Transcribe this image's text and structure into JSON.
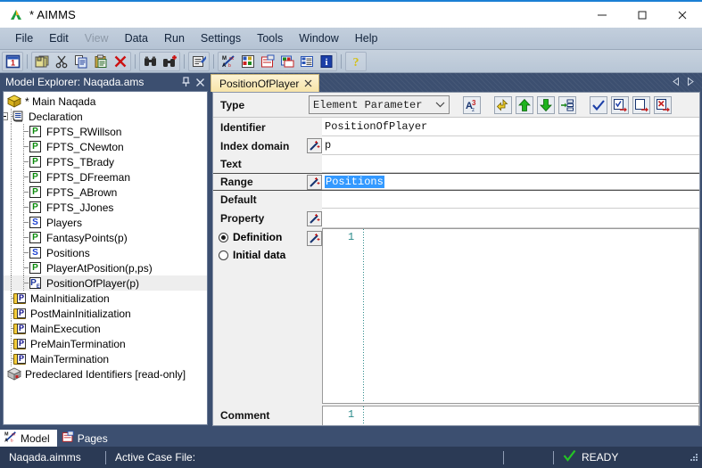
{
  "window": {
    "title": "* AIMMS",
    "logo_icon": "aimms-logo-icon",
    "minimize_label": "─",
    "maximize_label": "□",
    "close_label": "✕"
  },
  "menubar": {
    "items": [
      {
        "label": "File",
        "disabled": false
      },
      {
        "label": "Edit",
        "disabled": false
      },
      {
        "label": "View",
        "disabled": true
      },
      {
        "label": "Data",
        "disabled": false
      },
      {
        "label": "Run",
        "disabled": false
      },
      {
        "label": "Settings",
        "disabled": false
      },
      {
        "label": "Tools",
        "disabled": false
      },
      {
        "label": "Window",
        "disabled": false
      },
      {
        "label": "Help",
        "disabled": false
      }
    ]
  },
  "toolbar": {
    "groups": [
      {
        "buttons": [
          {
            "icon": "calendar-one-icon",
            "name": "new-project-button"
          }
        ]
      },
      {
        "buttons": [
          {
            "icon": "copy-stack-icon",
            "name": "duplicate-button"
          },
          {
            "icon": "scissors-icon",
            "name": "cut-button"
          },
          {
            "icon": "copy-icon",
            "name": "copy-button"
          },
          {
            "icon": "paste-icon",
            "name": "paste-button"
          },
          {
            "icon": "red-x-icon",
            "name": "delete-button"
          }
        ]
      },
      {
        "buttons": [
          {
            "icon": "binoculars-icon",
            "name": "find-button"
          },
          {
            "icon": "binoculars-plus-icon",
            "name": "find-next-button"
          }
        ]
      },
      {
        "buttons": [
          {
            "icon": "page-pen-icon",
            "name": "edit-attributes-button"
          }
        ]
      },
      {
        "buttons": [
          {
            "icon": "model-axes-icon",
            "name": "model-explorer-button"
          },
          {
            "icon": "identifier-grid-icon",
            "name": "identifier-selector-button"
          },
          {
            "icon": "page-manager-icon",
            "name": "page-manager-button"
          },
          {
            "icon": "template-manager-icon",
            "name": "template-manager-button"
          },
          {
            "icon": "list-panel-icon",
            "name": "data-manager-button"
          },
          {
            "icon": "info-blue-icon",
            "name": "properties-button"
          }
        ]
      },
      {
        "buttons": [
          {
            "icon": "question-help-icon",
            "name": "help-button"
          }
        ]
      }
    ]
  },
  "model_explorer": {
    "header_title": "Model Explorer: Naqada.ams",
    "pin_icon": "pin-icon",
    "close_icon": "close-icon",
    "nodes": [
      {
        "label": "* Main Naqada",
        "icon": "yellow-box-icon",
        "depth": 0,
        "selected": false,
        "expander": "none"
      },
      {
        "label": "Declaration",
        "icon": "declaration-icon",
        "depth": 1,
        "selected": false,
        "expander": "minus"
      },
      {
        "label": "FPTS_RWillson",
        "icon": "parameter-p-icon",
        "depth": 2,
        "selected": false,
        "expander": "none"
      },
      {
        "label": "FPTS_CNewton",
        "icon": "parameter-p-icon",
        "depth": 2,
        "selected": false,
        "expander": "none"
      },
      {
        "label": "FPTS_TBrady",
        "icon": "parameter-p-icon",
        "depth": 2,
        "selected": false,
        "expander": "none"
      },
      {
        "label": "FPTS_DFreeman",
        "icon": "parameter-p-icon",
        "depth": 2,
        "selected": false,
        "expander": "none"
      },
      {
        "label": "FPTS_ABrown",
        "icon": "parameter-p-icon",
        "depth": 2,
        "selected": false,
        "expander": "none"
      },
      {
        "label": "FPTS_JJones",
        "icon": "parameter-p-icon",
        "depth": 2,
        "selected": false,
        "expander": "none"
      },
      {
        "label": "Players",
        "icon": "set-s-icon",
        "depth": 2,
        "selected": false,
        "expander": "none"
      },
      {
        "label": "FantasyPoints(p)",
        "icon": "parameter-p-icon",
        "depth": 2,
        "selected": false,
        "expander": "none"
      },
      {
        "label": "Positions",
        "icon": "set-s-icon",
        "depth": 2,
        "selected": false,
        "expander": "none"
      },
      {
        "label": "PlayerAtPosition(p,ps)",
        "icon": "parameter-p-icon",
        "depth": 2,
        "selected": false,
        "expander": "none"
      },
      {
        "label": "PositionOfPlayer(p)",
        "icon": "element-parameter-icon",
        "depth": 2,
        "selected": true,
        "expander": "none"
      },
      {
        "label": "MainInitialization",
        "icon": "procedure-folder-icon",
        "depth": 1,
        "selected": false,
        "expander": "none"
      },
      {
        "label": "PostMainInitialization",
        "icon": "procedure-folder-icon",
        "depth": 1,
        "selected": false,
        "expander": "none"
      },
      {
        "label": "MainExecution",
        "icon": "procedure-folder-icon",
        "depth": 1,
        "selected": false,
        "expander": "none"
      },
      {
        "label": "PreMainTermination",
        "icon": "procedure-folder-icon",
        "depth": 1,
        "selected": false,
        "expander": "none"
      },
      {
        "label": "MainTermination",
        "icon": "procedure-folder-icon",
        "depth": 1,
        "selected": false,
        "expander": "none"
      },
      {
        "label": "Predeclared Identifiers [read-only]",
        "icon": "grey-box-icon",
        "depth": 0,
        "selected": false,
        "expander": "none"
      }
    ],
    "tabs": [
      {
        "label": "Model",
        "icon": "model-axes-icon",
        "active": true
      },
      {
        "label": "Pages",
        "icon": "page-manager-icon",
        "active": false
      }
    ]
  },
  "editor": {
    "tab": {
      "label": "PositionOfPlayer",
      "close_icon": "close-icon"
    },
    "nav_prev_icon": "triangle-left-icon",
    "nav_next_icon": "triangle-right-icon",
    "attributes": {
      "type_label": "Type",
      "type_value": "Element Parameter",
      "identifier_label": "Identifier",
      "identifier_value": "PositionOfPlayer",
      "index_domain_label": "Index domain",
      "index_domain_value": "p",
      "text_label": "Text",
      "text_value": "",
      "range_label": "Range",
      "range_value": "Positions",
      "default_label": "Default",
      "default_value": "",
      "property_label": "Property",
      "property_value": "",
      "definition_label": "Definition",
      "initial_data_label": "Initial data",
      "comment_label": "Comment",
      "definition_line_number": "1",
      "comment_line_number": "1"
    },
    "form_buttons": [
      {
        "icon": "sort-az-icon",
        "name": "sort-attributes-button"
      },
      {
        "icon": "arrow-up-left-yellow-icon",
        "name": "go-to-parent-button"
      },
      {
        "icon": "arrow-up-green-icon",
        "name": "previous-identifier-button"
      },
      {
        "icon": "arrow-down-green-icon",
        "name": "next-identifier-button"
      },
      {
        "icon": "insert-node-icon",
        "name": "insert-identifier-button"
      },
      {
        "icon": "check-blue-icon",
        "name": "check-syntax-button"
      },
      {
        "icon": "check-export-icon",
        "name": "commit-changes-button"
      },
      {
        "icon": "page-export-icon",
        "name": "export-attributes-button"
      },
      {
        "icon": "cancel-export-icon",
        "name": "discard-changes-button"
      }
    ]
  },
  "statusbar": {
    "project_file": "Naqada.aimms",
    "active_case_label": "Active Case File:",
    "active_case_value": "",
    "ready_label": "READY",
    "ready_icon": "green-check-icon",
    "resize_grip_icon": "resize-grip-icon"
  },
  "colors": {
    "accent_blue": "#1b7fd4",
    "panel_navy": "#3c4f70",
    "status_navy": "#2b3a55",
    "tab_cream": "#f7e4a8",
    "selection_blue": "#3399ff",
    "param_green": "#0a8a0a",
    "set_blue": "#1a3fcf"
  }
}
